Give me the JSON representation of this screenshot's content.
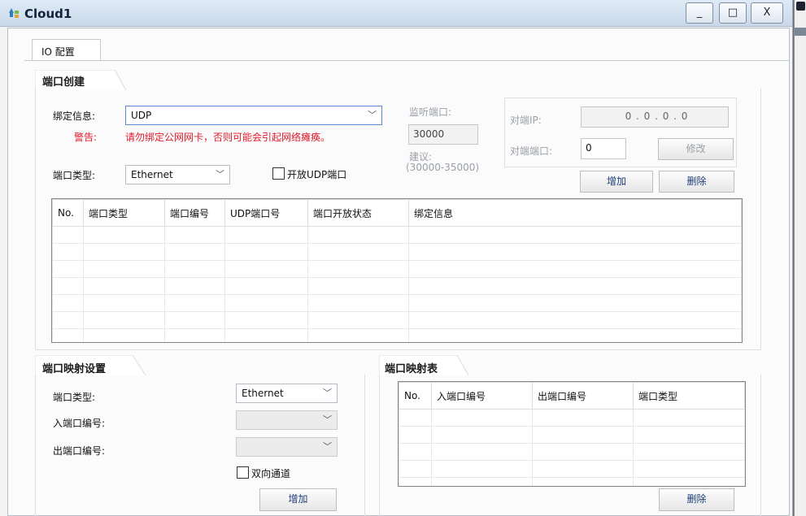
{
  "window": {
    "title": "Cloud1",
    "minimize": "_",
    "maximize": "□",
    "close": "X"
  },
  "tabs": [
    {
      "label": "IO 配置"
    }
  ],
  "port_create": {
    "group_title": "端口创建",
    "bind_label": "绑定信息:",
    "bind_value": "UDP",
    "warning_label": "警告:",
    "warning_text": "请勿绑定公网网卡，否则可能会引起网络瘫痪。",
    "port_type_label": "端口类型:",
    "port_type_value": "Ethernet",
    "open_udp_label": "开放UDP端口",
    "listen_label": "监听端口:",
    "listen_value": "30000",
    "suggest_label": "建议:",
    "suggest_range": "(30000-35000)",
    "peer_ip_label": "对端IP:",
    "peer_ip_value": "0 . 0 . 0 . 0",
    "peer_port_label": "对端端口:",
    "peer_port_value": "0",
    "modify_button": "修改",
    "add_button": "增加",
    "delete_button": "删除",
    "table_headers": [
      "No.",
      "端口类型",
      "端口编号",
      "UDP端口号",
      "端口开放状态",
      "绑定信息"
    ]
  },
  "port_mapping": {
    "group_title": "端口映射设置",
    "port_type_label": "端口类型:",
    "port_type_value": "Ethernet",
    "in_port_label": "入端口编号:",
    "out_port_label": "出端口编号:",
    "bidirectional_label": "双向通道",
    "add_button": "增加"
  },
  "mapping_table": {
    "group_title": "端口映射表",
    "headers": [
      "No.",
      "入端口编号",
      "出端口编号",
      "端口类型"
    ],
    "delete_button": "删除"
  }
}
